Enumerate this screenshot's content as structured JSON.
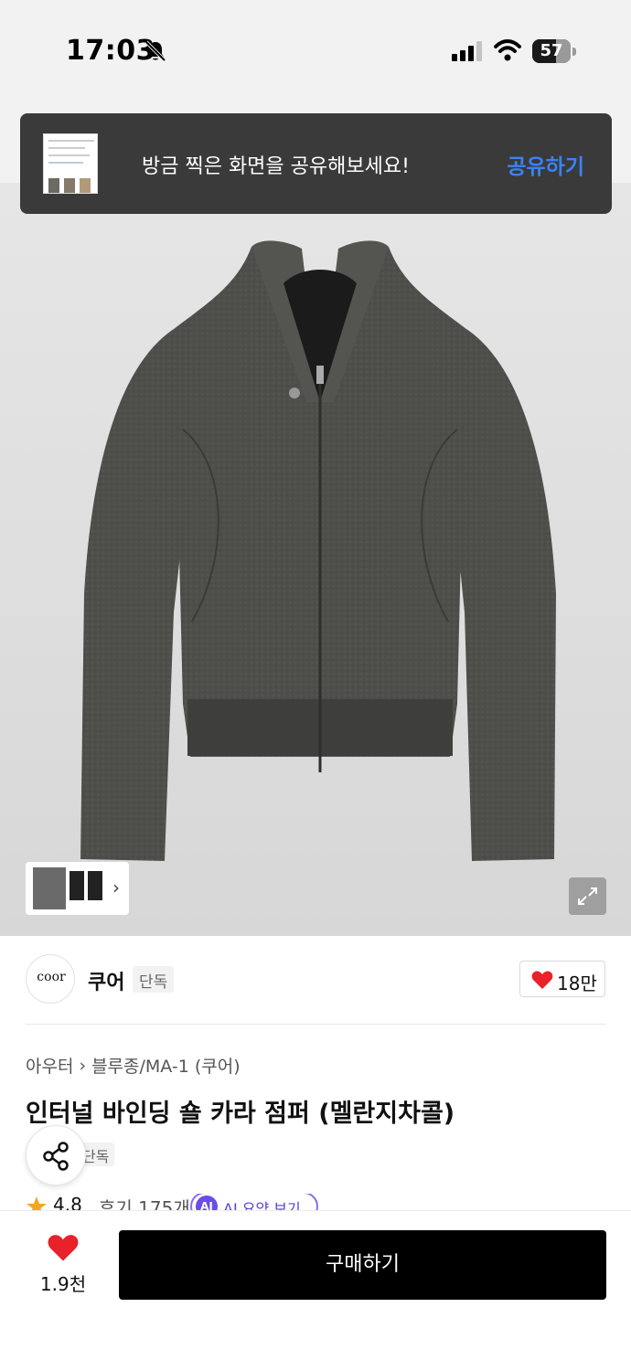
{
  "status_bar": {
    "time": "17:03",
    "battery": "57"
  },
  "toast": {
    "message": "방금 찍은 화면을 공유해보세요!",
    "action": "공유하기"
  },
  "product_image": {
    "icon": "expand-icon"
  },
  "brand": {
    "logo_text": "coor",
    "name": "쿠어",
    "tag": "단독",
    "likes": "18만"
  },
  "product": {
    "breadcrumb": [
      "아우터",
      "블루종/MA-1 (쿠어)"
    ],
    "title": "인터널 바인딩 숄 카라 점퍼 (멜란지차콜)",
    "tag": "단독",
    "rating": "4.8",
    "reviews": "후기 175개",
    "ai_badge": "AI",
    "ai_label": "AI 요약 보기"
  },
  "bottom_bar": {
    "wish_count": "1.9천",
    "buy_label": "구매하기"
  },
  "colors": {
    "accent_blue": "#3b82f6",
    "heart_red": "#e8212b",
    "ai_purple": "#6b4de6"
  }
}
